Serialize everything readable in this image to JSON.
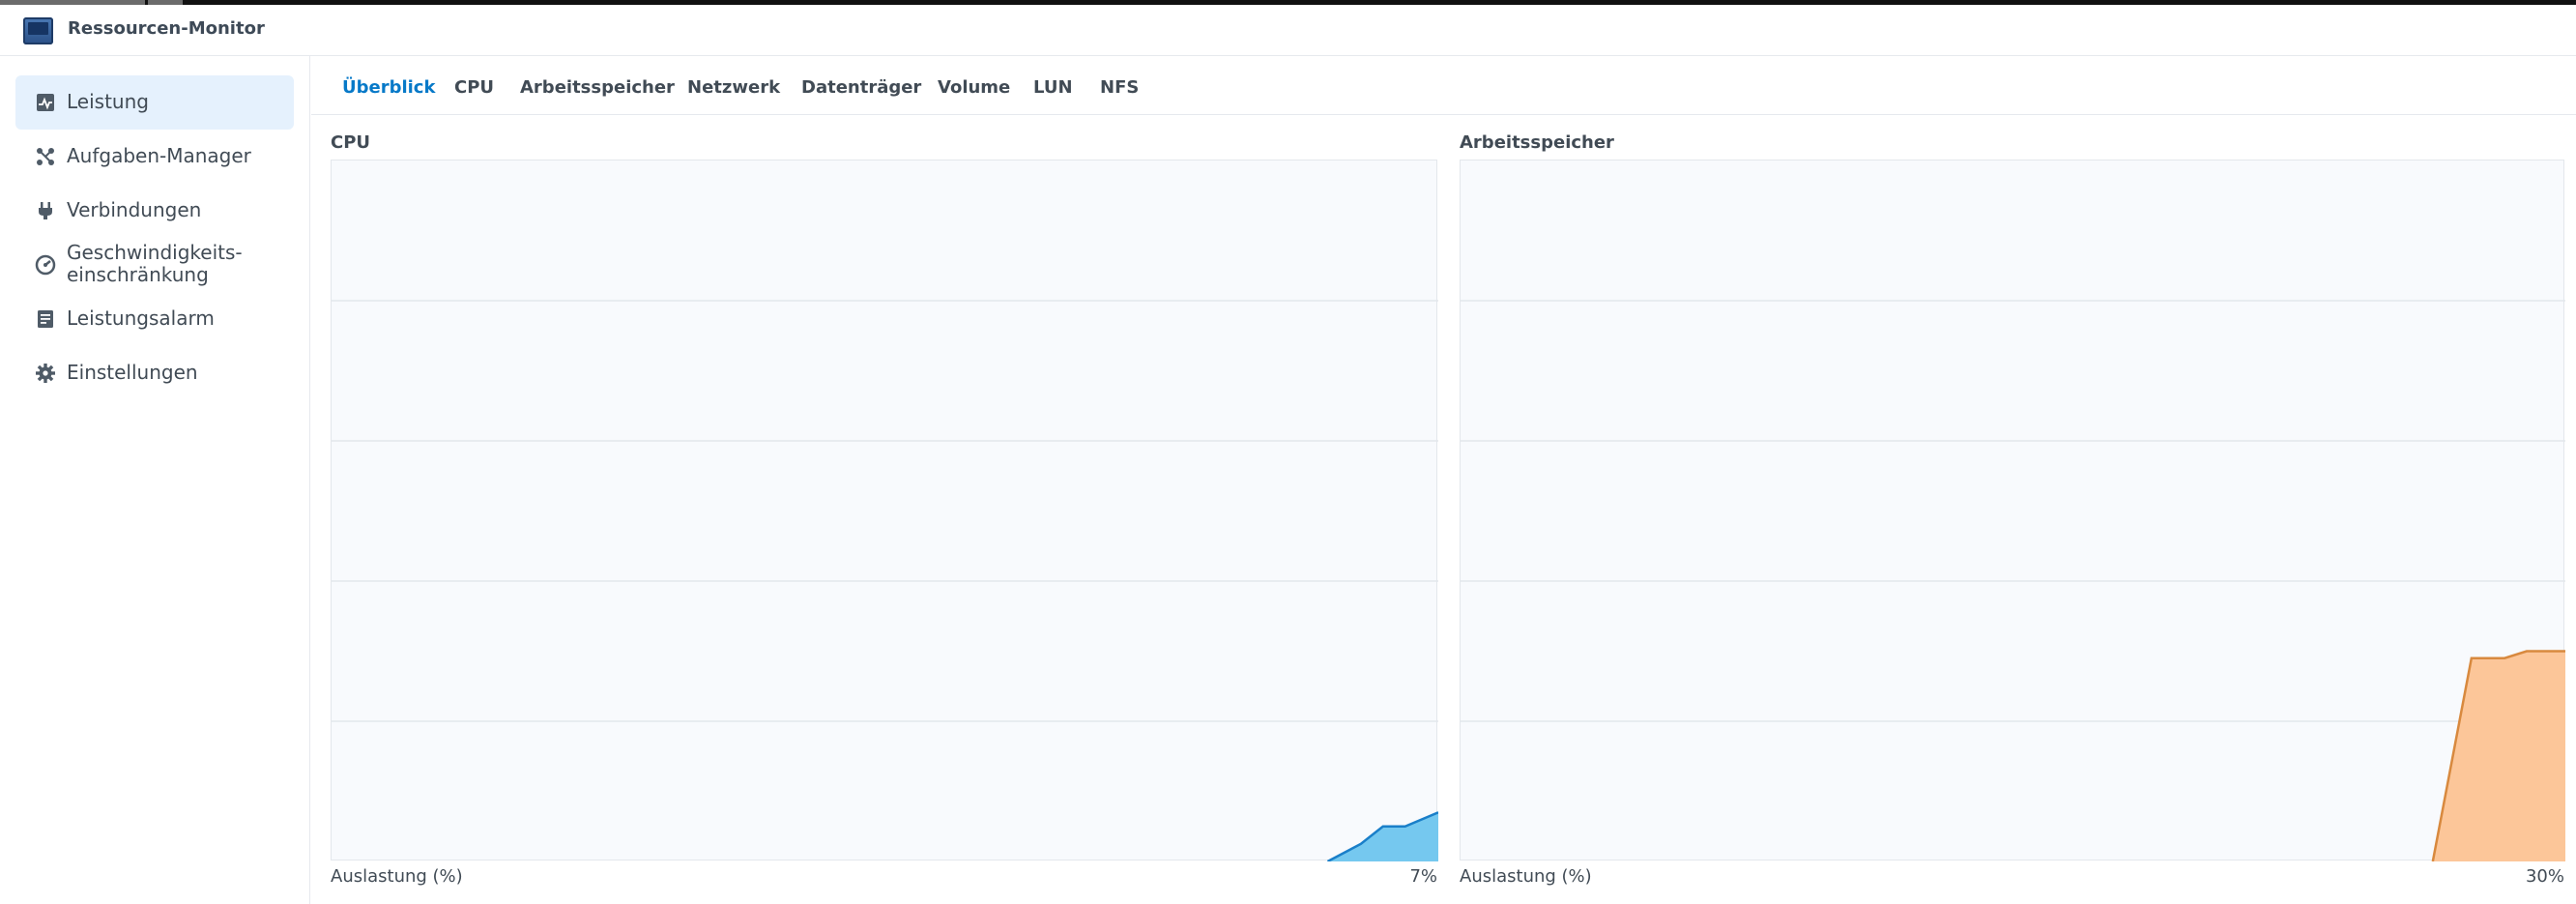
{
  "app": {
    "title": "Ressourcen-Monitor"
  },
  "sidebar": {
    "items": [
      {
        "label": "Leistung",
        "icon": "performance-chart-icon",
        "active": true
      },
      {
        "label": "Aufgaben-Manager",
        "icon": "task-manager-icon",
        "active": false
      },
      {
        "label": "Verbindungen",
        "icon": "plug-icon",
        "active": false
      },
      {
        "label_line1": "Geschwindigkeits-",
        "label_line2": "einschränkung",
        "icon": "speed-gauge-icon",
        "active": false
      },
      {
        "label": "Leistungsalarm",
        "icon": "alarm-list-icon",
        "active": false
      },
      {
        "label": "Einstellungen",
        "icon": "gear-icon",
        "active": false
      }
    ]
  },
  "tabs": [
    {
      "label": "Überblick",
      "active": true
    },
    {
      "label": "CPU"
    },
    {
      "label": "Arbeitsspeicher"
    },
    {
      "label": "Netzwerk"
    },
    {
      "label": "Datenträger"
    },
    {
      "label": "Volume"
    },
    {
      "label": "LUN"
    },
    {
      "label": "NFS"
    }
  ],
  "colors": {
    "accent": "#0779c8",
    "cpu_line": "#1a7fc9",
    "cpu_fill": "#75c8ef",
    "mem_line": "#d8893e",
    "mem_fill": "#fcc699",
    "grid": "#e3e7ec"
  },
  "charts": {
    "cpu": {
      "title": "CPU",
      "footer_label": "Auslastung  (%)",
      "footer_value": "7%"
    },
    "memory": {
      "title": "Arbeitsspeicher",
      "footer_label": "Auslastung  (%)",
      "footer_value": "30%"
    }
  },
  "chart_data": [
    {
      "type": "area",
      "title": "CPU",
      "ylabel": "Auslastung  (%)",
      "ylim": [
        0,
        100
      ],
      "grid": true,
      "x": [
        0,
        89,
        90,
        93,
        95,
        97,
        100
      ],
      "values": [
        0,
        0,
        0,
        2.5,
        5,
        5,
        7
      ]
    },
    {
      "type": "area",
      "title": "Arbeitsspeicher",
      "ylabel": "Auslastung  (%)",
      "ylim": [
        0,
        100
      ],
      "grid": true,
      "x": [
        0,
        88,
        91.5,
        94.5,
        96.5,
        100
      ],
      "values": [
        0,
        0,
        29,
        29,
        30,
        30
      ]
    }
  ]
}
